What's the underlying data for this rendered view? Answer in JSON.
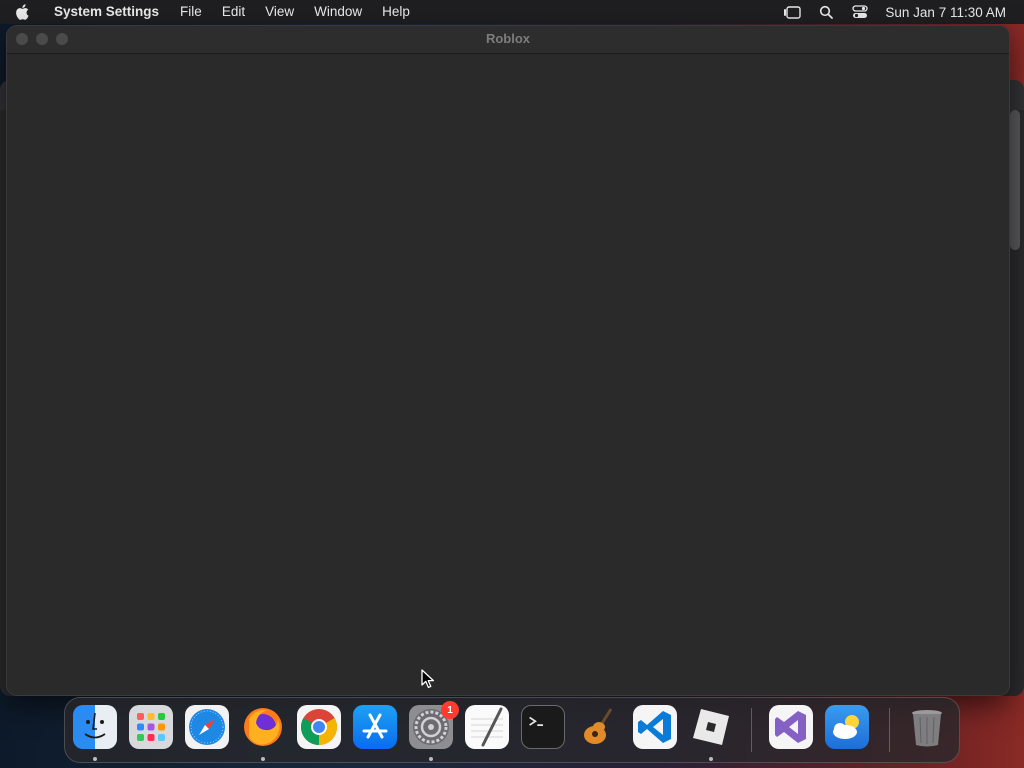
{
  "menubar": {
    "app_name": "System Settings",
    "menus": [
      "File",
      "Edit",
      "View",
      "Window",
      "Help"
    ],
    "clock": "Sun Jan 7  11:30 AM"
  },
  "window": {
    "title": "Roblox"
  },
  "dock": {
    "apps": [
      "finder",
      "launchpad",
      "safari",
      "firefox",
      "chrome",
      "app-store",
      "system-settings",
      "textedit",
      "terminal",
      "garageband",
      "vscode",
      "roblox",
      "visual-studio",
      "weather"
    ],
    "system_settings_badge": "1"
  },
  "colors": {
    "menubar_bg": "#1f1f21",
    "window_bg": "#2a2a2a",
    "badge": "#ff3b30"
  }
}
